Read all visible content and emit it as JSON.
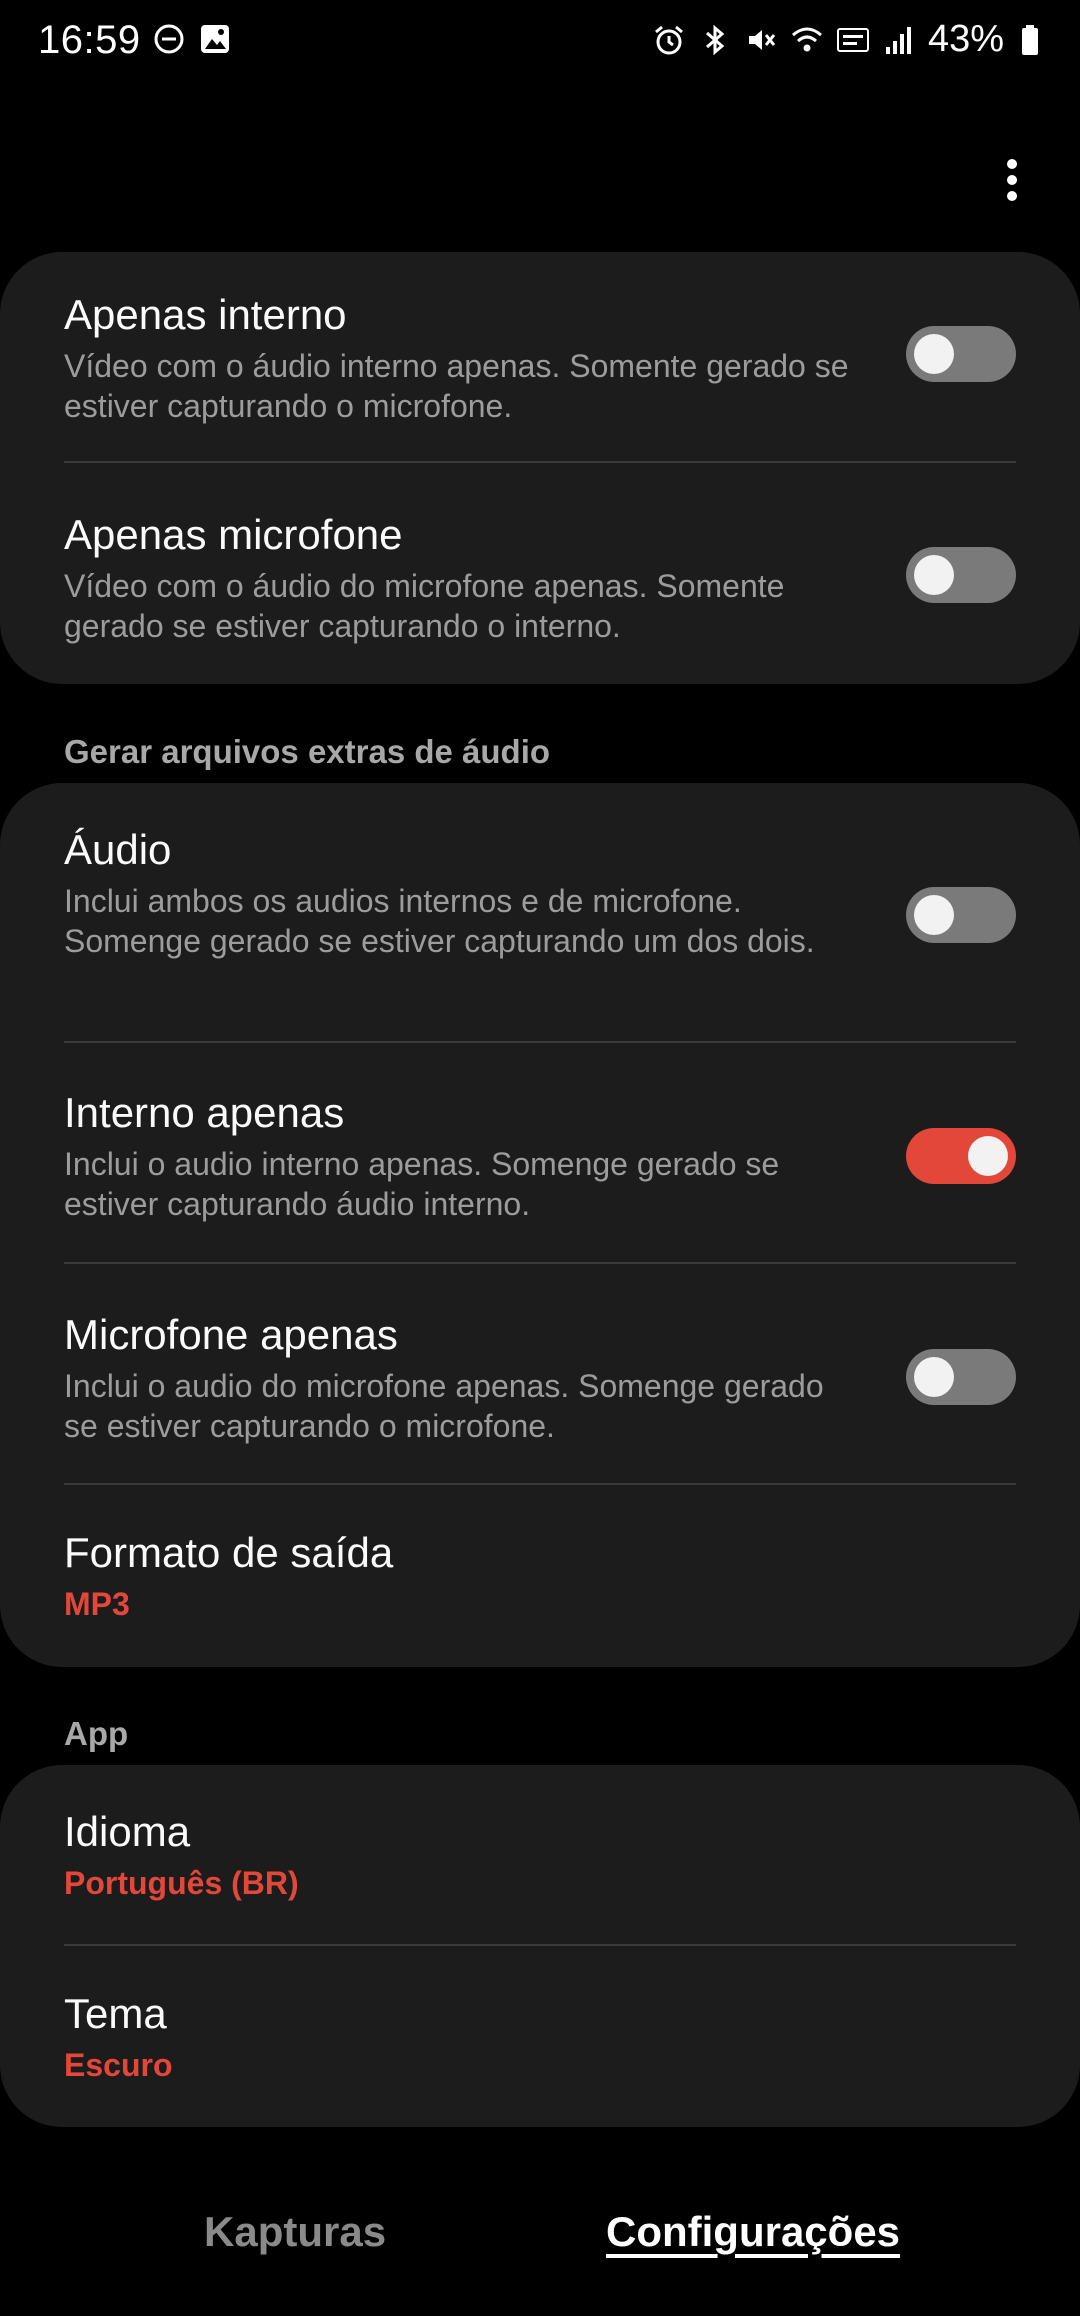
{
  "status_bar": {
    "time": "16:59",
    "battery": "43%",
    "icons": [
      "do-not-disturb-icon",
      "gallery-icon",
      "alarm-icon",
      "bluetooth-icon",
      "mute-icon",
      "wifi-icon",
      "volte-icon",
      "signal-icon",
      "battery-icon"
    ]
  },
  "video_card": {
    "items": [
      {
        "title": "Apenas interno",
        "desc": "Vídeo com o áudio interno apenas. Somente gerado se estiver capturando o microfone.",
        "checked": false
      },
      {
        "title": "Apenas microfone",
        "desc": "Vídeo com o áudio do microfone apenas. Somente gerado se estiver capturando o interno.",
        "checked": false
      }
    ]
  },
  "audio_section": {
    "header": "Gerar arquivos extras de áudio",
    "items": [
      {
        "title": "Áudio",
        "desc": "Inclui ambos os audios internos e de microfone. Somenge gerado se estiver capturando um dos dois.",
        "checked": false
      },
      {
        "title": "Interno apenas",
        "desc": "Inclui o audio interno apenas. Somenge gerado se estiver capturando áudio interno.",
        "checked": true
      },
      {
        "title": "Microfone apenas",
        "desc": "Inclui o audio do microfone apenas. Somenge gerado se estiver capturando o microfone.",
        "checked": false
      }
    ],
    "output_format": {
      "title": "Formato de saída",
      "value": "MP3"
    }
  },
  "app_section": {
    "header": "App",
    "language": {
      "title": "Idioma",
      "value": "Português (BR)"
    },
    "theme": {
      "title": "Tema",
      "value": "Escuro"
    }
  },
  "bottom_nav": {
    "tabs": [
      {
        "label": "Kapturas",
        "active": false
      },
      {
        "label": "Configurações",
        "active": true
      }
    ]
  },
  "colors": {
    "accent": "#e2473a",
    "card": "#1c1c1c",
    "background": "#000000"
  }
}
